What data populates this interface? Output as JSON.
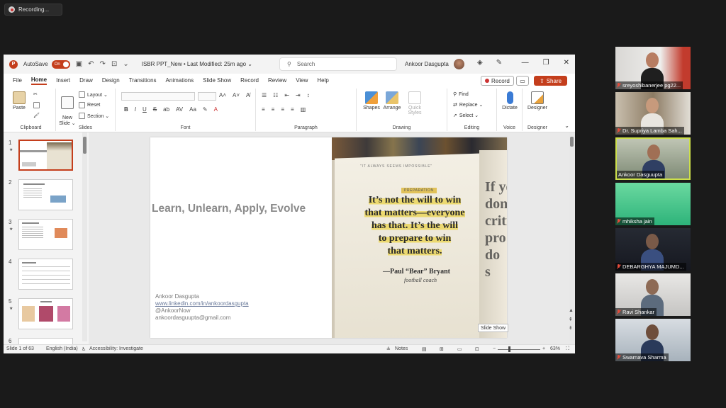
{
  "recording": {
    "label": "Recording..."
  },
  "ppt": {
    "title_bar": {
      "autosave": "AutoSave",
      "toggle": "On",
      "doc_title": "ISBR PPT_New • Last Modified: 25m ago ⌄",
      "search_placeholder": "Search",
      "user": "Ankoor Dasgupta"
    },
    "menu": [
      "File",
      "Home",
      "Insert",
      "Draw",
      "Design",
      "Transitions",
      "Animations",
      "Slide Show",
      "Record",
      "Review",
      "View",
      "Help"
    ],
    "menu_active": "Home",
    "actions": {
      "record": "Record",
      "share": "Share"
    },
    "ribbon": {
      "clipboard": {
        "label": "Clipboard",
        "paste": "Paste"
      },
      "slides": {
        "label": "Slides",
        "new_slide": "New\nSlide ⌄",
        "layout": "Layout ⌄",
        "reset": "Reset",
        "section": "Section ⌄"
      },
      "font": {
        "label": "Font"
      },
      "paragraph": {
        "label": "Paragraph"
      },
      "drawing": {
        "label": "Drawing",
        "shapes": "Shapes",
        "arrange": "Arrange",
        "quick_styles": "Quick Styles"
      },
      "editing": {
        "label": "Editing",
        "find": "Find",
        "replace": "Replace ⌄",
        "select": "Select ⌄"
      },
      "voice": {
        "label": "Voice",
        "dictate": "Dictate"
      },
      "designer": {
        "label": "Designer",
        "designer": "Designer"
      }
    },
    "thumbnails": [
      {
        "num": "1",
        "star": "★"
      },
      {
        "num": "2",
        "star": ""
      },
      {
        "num": "3",
        "star": "★"
      },
      {
        "num": "4",
        "star": ""
      },
      {
        "num": "5",
        "star": "★"
      },
      {
        "num": "6",
        "star": ""
      }
    ],
    "slide": {
      "title": "Learn, Unlearn, Apply, Evolve",
      "contact_name": "Ankoor Dasgupta",
      "contact_link": "www.linkedin.com/in/ankoordasgupta",
      "contact_handle": "@AnkoorNow",
      "contact_email": "ankoordasguupta@gmail.com",
      "photo": {
        "kicker": "\"IT ALWAYS SEEMS IMPOSSIBLE\"",
        "tag": "PREPARATION",
        "quote_lines": [
          "It’s not the will to win",
          "that matters—everyone",
          "has that. It’s the will",
          "to prepare to win",
          "that matters."
        ],
        "author": "—Paul “Bear” Bryant",
        "role": "football coach",
        "right_page": "If yo\ndon't\ncritic\npro\ndo\ns"
      }
    },
    "tooltip": "Slide Show",
    "status": {
      "slide_of": "Slide 1 of 63",
      "language": "English (India)",
      "accessibility": "Accessibility: Investigate",
      "notes": "Notes",
      "zoom": "63%"
    }
  },
  "participants": [
    {
      "name": "sreyoshibanerjee pg22..."
    },
    {
      "name": "Dr. Supriya Lamba Sah..."
    },
    {
      "name": "Ankoor Dasguupta",
      "active": true
    },
    {
      "name": "mhiksha jain"
    },
    {
      "name": "DEBARGHYA MAJUMD..."
    },
    {
      "name": "Ravi Shankar"
    },
    {
      "name": "Swarnava Sharma"
    }
  ],
  "colors": {
    "accent": "#c43e1c",
    "active_speaker": "#cde04b",
    "mic_muted": "#e34b3b"
  }
}
